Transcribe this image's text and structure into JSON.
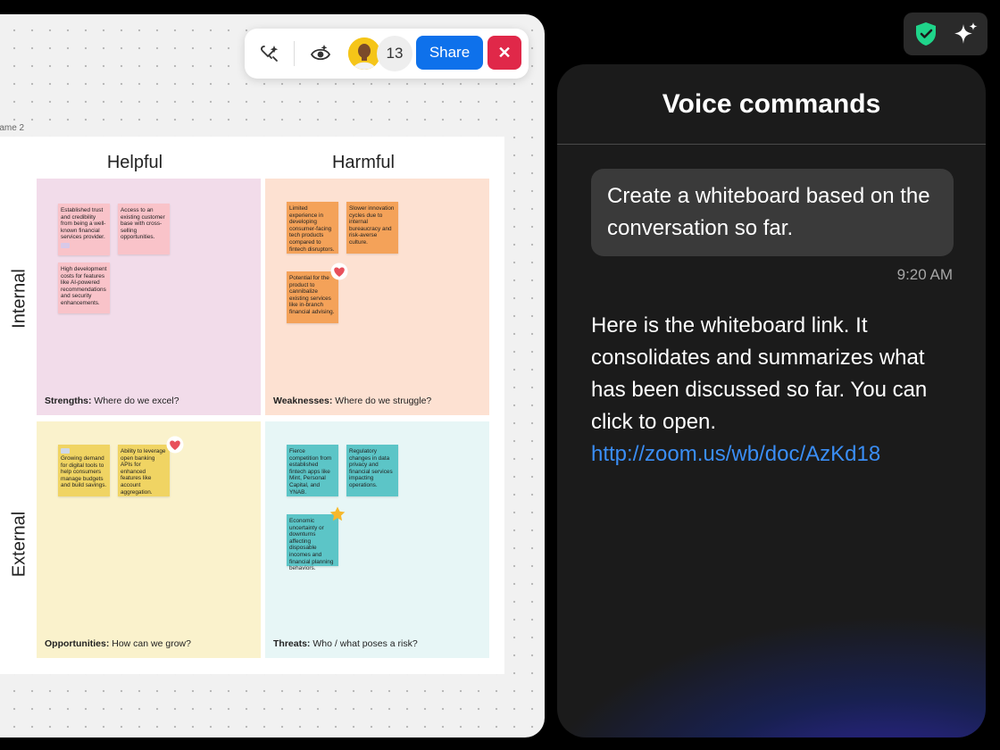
{
  "canvas": {
    "frame_label": "rame 2",
    "toolbar": {
      "participant_count": "13",
      "share_label": "Share",
      "close_label": "✕",
      "icons": [
        "ai-sparkle-icon",
        "visibility-eye-icon"
      ]
    },
    "columns": {
      "left": "Helpful",
      "right": "Harmful"
    },
    "rows": {
      "top": "Internal",
      "bottom": "External"
    },
    "quadrants": {
      "strengths": {
        "title": "Strengths:",
        "prompt": "Where do we excel?",
        "color": "#f2dcea"
      },
      "weaknesses": {
        "title": "Weaknesses:",
        "prompt": "Where do we struggle?",
        "color": "#fde1d2"
      },
      "opportunities": {
        "title": "Opportunities:",
        "prompt": "How can we grow?",
        "color": "#faf2cc"
      },
      "threats": {
        "title": "Threats:",
        "prompt": "Who / what poses a risk?",
        "color": "#e7f6f6"
      }
    },
    "notes": {
      "s1": "Established trust and credibility from being a well-known financial services provider.",
      "s2": "Access to an existing customer base with cross-selling opportunities.",
      "s3": "High development costs for features like AI-powered recommendations and security enhancements.",
      "w1": "Limited experience in developing consumer-facing tech products compared to fintech disruptors.",
      "w2": "Slower innovation cycles due to internal bureaucracy and risk-averse culture.",
      "w3": "Potential for the product to cannibalize existing services like in-branch financial advising.",
      "o1": "Growing demand for digital tools to help consumers manage budgets and build savings.",
      "o2": "Ability to leverage open banking APIs for enhanced features like account aggregation.",
      "t1": "Fierce competition from established fintech apps like Mint, Personal Capital, and YNAB.",
      "t2": "Regulatory changes in data privacy and financial services impacting operations.",
      "t3": "Economic uncertainty or downturns affecting disposable incomes and financial planning behaviors."
    }
  },
  "top_icons": [
    "shield-check-icon",
    "sparkle-icon"
  ],
  "panel": {
    "title": "Voice commands",
    "user_message": "Create a whiteboard based on the conversation so far.",
    "timestamp": "9:20 AM",
    "reply_text": "Here is the whiteboard link. It consolidates and summarizes what has been discussed so far. You can click to open.",
    "reply_link": "http://zoom.us/wb/doc/AzKd18"
  }
}
